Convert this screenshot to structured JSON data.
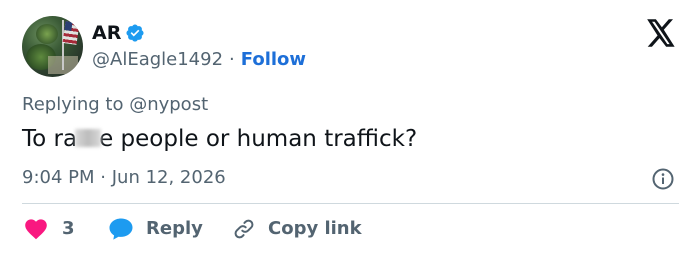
{
  "author": {
    "name": "AR",
    "handle": "@AlEagle1492",
    "separator": "·",
    "follow_label": "Follow",
    "verified": true
  },
  "brand": {
    "icon": "x-logo-icon"
  },
  "reply_context": {
    "text": "Replying to @nypost"
  },
  "tweet": {
    "text_before": "To ra",
    "text_after": "e people or human traffick?"
  },
  "meta": {
    "time": "9:04 PM",
    "separator": "·",
    "date": "Jun 12, 2026"
  },
  "actions": {
    "likes_count": "3",
    "reply_label": "Reply",
    "copy_link_label": "Copy link"
  },
  "colors": {
    "text_primary": "#0f1419",
    "text_secondary": "#536471",
    "link_blue": "#1d6fd8",
    "verified_blue": "#1d9bf0",
    "like_pink": "#f91880",
    "divider": "#cfd9de"
  }
}
